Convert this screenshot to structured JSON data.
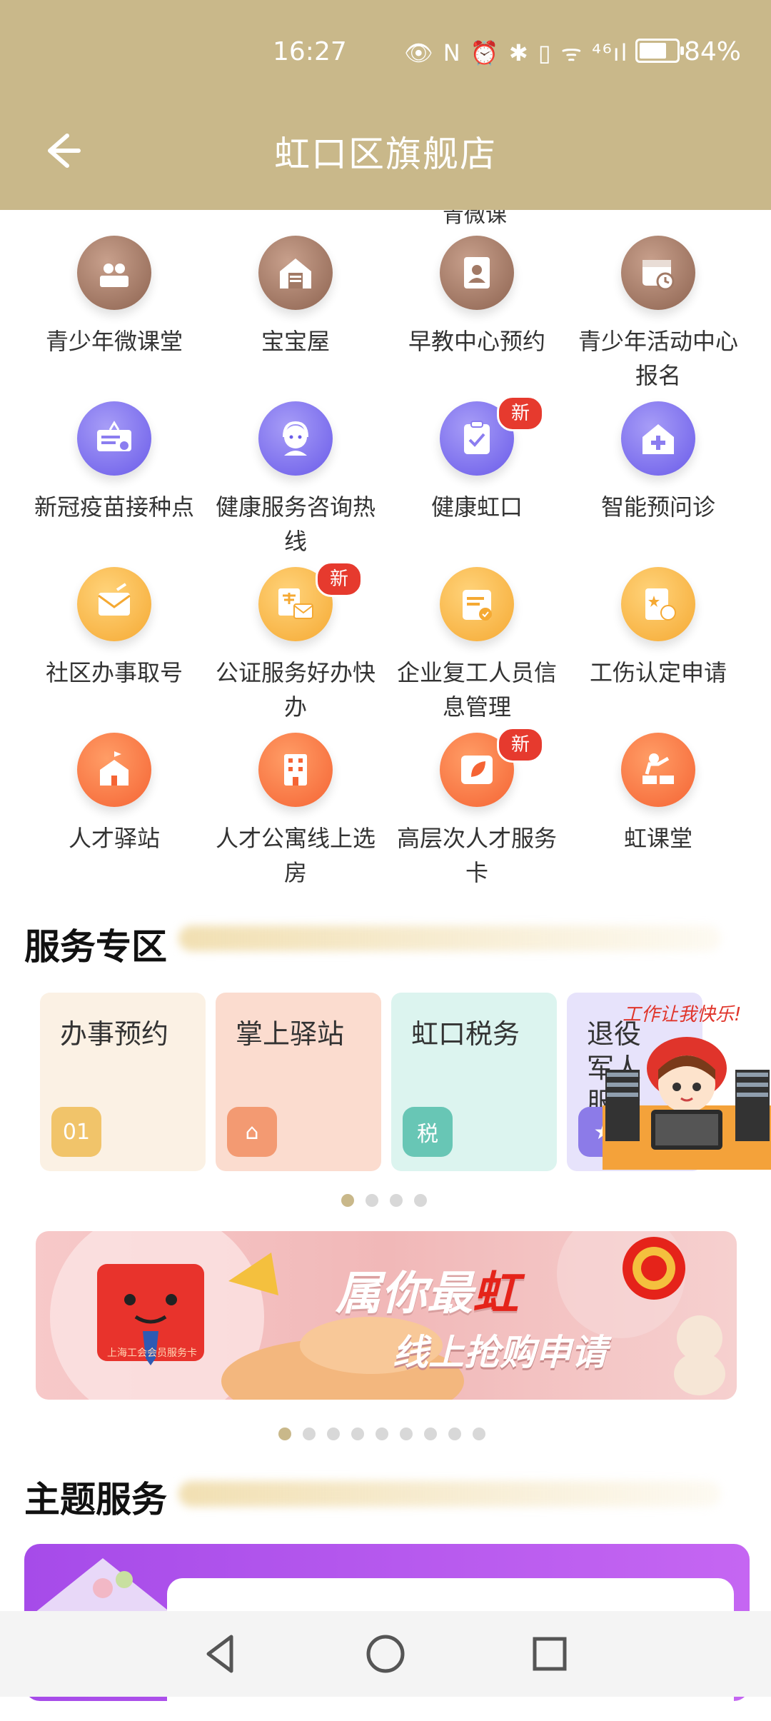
{
  "status_bar": {
    "time": "16:27",
    "icons": "👁 N ⏰ ✱ ▯ ᯤ ⁴⁶ıl",
    "battery_percent": "84%",
    "battery_level": 0.84
  },
  "header": {
    "title": "虹口区旗舰店",
    "back_icon": "arrow-left-icon"
  },
  "cut_off_label": "青微课",
  "grid": [
    {
      "label": "青少年微课堂",
      "icon": "classroom-icon",
      "color": "brown",
      "new": false
    },
    {
      "label": "宝宝屋",
      "icon": "house-icon",
      "color": "brown",
      "new": false
    },
    {
      "label": "早教中心预约",
      "icon": "portrait-icon",
      "color": "brown",
      "new": false
    },
    {
      "label": "青少年活动中心报名",
      "icon": "calendar-clock-icon",
      "color": "brown",
      "new": false
    },
    {
      "label": "新冠疫苗接种点",
      "icon": "sign-board-icon",
      "color": "purple",
      "new": false
    },
    {
      "label": "健康服务咨询热线",
      "icon": "headset-person-icon",
      "color": "purple",
      "new": false
    },
    {
      "label": "健康虹口",
      "icon": "clipboard-check-icon",
      "color": "purple",
      "new": true
    },
    {
      "label": "智能预问诊",
      "icon": "medical-house-icon",
      "color": "purple",
      "new": false
    },
    {
      "label": "社区办事取号",
      "icon": "envelope-icon",
      "color": "yellow",
      "new": false
    },
    {
      "label": "公证服务好办快办",
      "icon": "scale-mail-icon",
      "color": "yellow",
      "new": true
    },
    {
      "label": "企业复工人员信息管理",
      "icon": "notepad-check-icon",
      "color": "yellow",
      "new": false
    },
    {
      "label": "工伤认定申请",
      "icon": "document-star-icon",
      "color": "yellow",
      "new": false
    },
    {
      "label": "人才驿站",
      "icon": "building-flag-icon",
      "color": "orange",
      "new": false
    },
    {
      "label": "人才公寓线上选房",
      "icon": "apartment-icon",
      "color": "orange",
      "new": false
    },
    {
      "label": "高层次人才服务卡",
      "icon": "leaf-card-icon",
      "color": "orange",
      "new": true
    },
    {
      "label": "虹课堂",
      "icon": "teacher-icon",
      "color": "orange",
      "new": false
    }
  ],
  "new_badge": "新",
  "service_zone": {
    "title": "服务专区",
    "cards": [
      {
        "label": "办事预约",
        "icon": "calendar-icon",
        "icon_text": "01",
        "bg": "#fbf1e4",
        "icon_bg": "#f1c46a"
      },
      {
        "label": "掌上驿站",
        "icon": "shop-icon",
        "icon_text": "⌂",
        "bg": "#fbdccf",
        "icon_bg": "#f39a72"
      },
      {
        "label": "虹口税务",
        "icon": "tax-hand-icon",
        "icon_text": "税",
        "bg": "#dcf4ef",
        "icon_bg": "#68c6b5"
      },
      {
        "label": "退役军人服务",
        "icon": "badge-icon",
        "icon_text": "★",
        "bg": "#e7e3fb",
        "icon_bg": "#8c7be8"
      }
    ],
    "mascot_caption": "工作让我快乐!",
    "pager_count": 4,
    "pager_active": 0
  },
  "banner": {
    "headline_part1": "属你最",
    "headline_part2": "虹",
    "subline": "线上抢购申请",
    "card_text": "上海工会会员服务卡",
    "pager_count": 9,
    "pager_active": 0
  },
  "theme_zone": {
    "title": "主题服务"
  },
  "nav": {
    "back": "triangle-back-icon",
    "home": "circle-home-icon",
    "recents": "square-recents-icon"
  }
}
